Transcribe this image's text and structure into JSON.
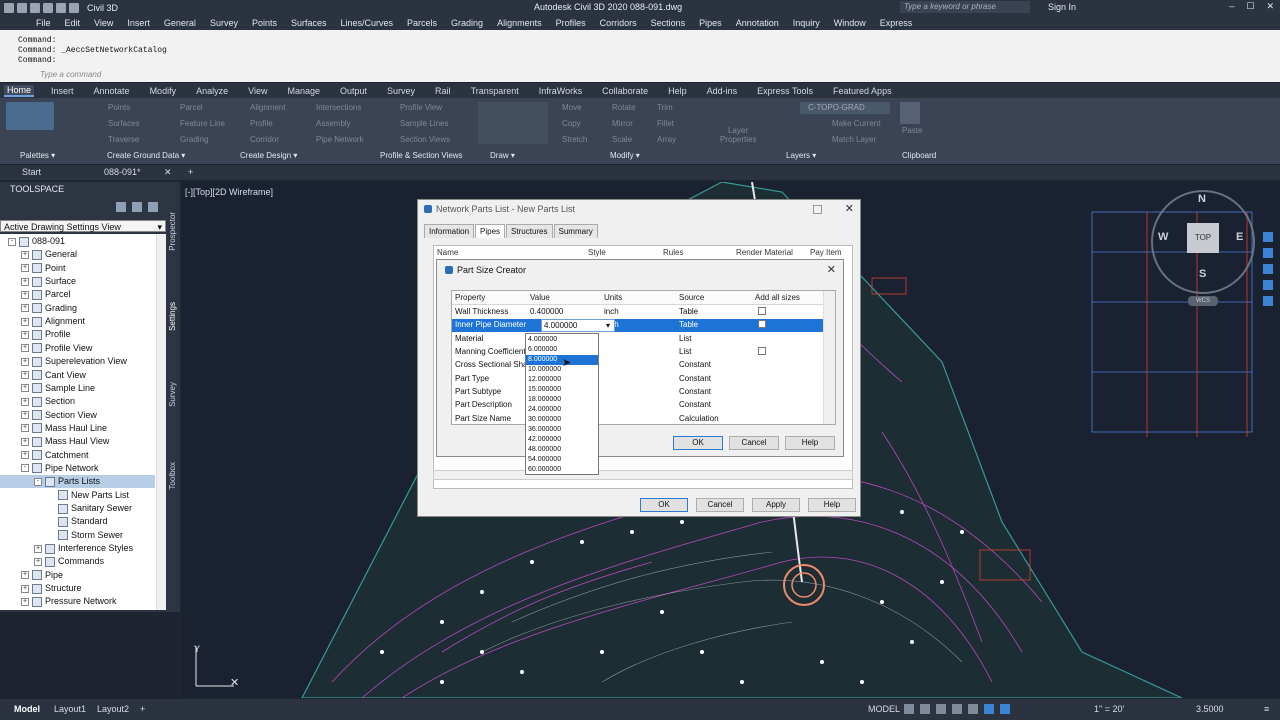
{
  "titlebar": {
    "app_name": "Civil 3D",
    "doc_title": "Autodesk Civil 3D 2020    088-091.dwg",
    "search_placeholder": "Type a keyword or phrase",
    "sign_in": "Sign In"
  },
  "menubar": [
    "File",
    "Edit",
    "View",
    "Insert",
    "General",
    "Survey",
    "Points",
    "Surfaces",
    "Lines/Curves",
    "Parcels",
    "Grading",
    "Alignments",
    "Profiles",
    "Corridors",
    "Sections",
    "Pipes",
    "Annotation",
    "Inquiry",
    "Window",
    "Express"
  ],
  "command": {
    "lines": [
      "Command:",
      "Command: _AeccSetNetworkCatalog",
      "Command:"
    ],
    "input_placeholder": "Type a command"
  },
  "ribbon_tabs": [
    "Home",
    "Insert",
    "Annotate",
    "Modify",
    "Analyze",
    "View",
    "Manage",
    "Output",
    "Survey",
    "Rail",
    "Transparent",
    "InfraWorks",
    "Collaborate",
    "Help",
    "Add-ins",
    "Express Tools",
    "Featured Apps"
  ],
  "ribbon_active": "Home",
  "ribbon_panels": [
    "Palettes ▾",
    "Create Ground Data ▾",
    "Create Design ▾",
    "Profile & Section Views",
    "Draw ▾",
    "Modify ▾",
    "Layers ▾",
    "Clipboard"
  ],
  "ribbon_items": {
    "points": "Points",
    "surfaces": "Surfaces",
    "traverse": "Traverse",
    "parcel": "Parcel",
    "feature_line": "Feature Line",
    "grading": "Grading",
    "alignment": "Alignment",
    "profile": "Profile",
    "corridor": "Corridor",
    "intersections": "Intersections",
    "assembly": "Assembly",
    "pipe_network": "Pipe Network",
    "profile_view": "Profile View",
    "sample_lines": "Sample Lines",
    "section_views": "Section Views",
    "move": "Move",
    "copy": "Copy",
    "stretch": "Stretch",
    "rotate": "Rotate",
    "mirror": "Mirror",
    "scale": "Scale",
    "trim": "Trim",
    "fillet": "Fillet",
    "array": "Array",
    "layer_properties": "Layer Properties",
    "layer_name": "C-TOPO-GRAD",
    "make_current": "Make Current",
    "match_layer": "Match Layer",
    "paste": "Paste"
  },
  "doc_tabs": [
    "Start",
    "088-091*"
  ],
  "toolspace": {
    "title": "TOOLSPACE",
    "view": "Active Drawing Settings View",
    "side_tabs": [
      "Prospector",
      "Settings",
      "Survey",
      "Toolbox"
    ],
    "tree": [
      {
        "label": "088-091",
        "level": 0,
        "exp": "-"
      },
      {
        "label": "General",
        "level": 1,
        "exp": "+"
      },
      {
        "label": "Point",
        "level": 1,
        "exp": "+"
      },
      {
        "label": "Surface",
        "level": 1,
        "exp": "+"
      },
      {
        "label": "Parcel",
        "level": 1,
        "exp": "+"
      },
      {
        "label": "Grading",
        "level": 1,
        "exp": "+"
      },
      {
        "label": "Alignment",
        "level": 1,
        "exp": "+"
      },
      {
        "label": "Profile",
        "level": 1,
        "exp": "+"
      },
      {
        "label": "Profile View",
        "level": 1,
        "exp": "+"
      },
      {
        "label": "Superelevation View",
        "level": 1,
        "exp": "+"
      },
      {
        "label": "Cant View",
        "level": 1,
        "exp": "+"
      },
      {
        "label": "Sample Line",
        "level": 1,
        "exp": "+"
      },
      {
        "label": "Section",
        "level": 1,
        "exp": "+"
      },
      {
        "label": "Section View",
        "level": 1,
        "exp": "+"
      },
      {
        "label": "Mass Haul Line",
        "level": 1,
        "exp": "+"
      },
      {
        "label": "Mass Haul View",
        "level": 1,
        "exp": "+"
      },
      {
        "label": "Catchment",
        "level": 1,
        "exp": "+"
      },
      {
        "label": "Pipe Network",
        "level": 1,
        "exp": "-"
      },
      {
        "label": "Parts Lists",
        "level": 2,
        "exp": "-",
        "selected": true
      },
      {
        "label": "New Parts List",
        "level": 3,
        "exp": ""
      },
      {
        "label": "Sanitary Sewer",
        "level": 3,
        "exp": ""
      },
      {
        "label": "Standard",
        "level": 3,
        "exp": ""
      },
      {
        "label": "Storm Sewer",
        "level": 3,
        "exp": ""
      },
      {
        "label": "Interference Styles",
        "level": 2,
        "exp": "+"
      },
      {
        "label": "Commands",
        "level": 2,
        "exp": "+"
      },
      {
        "label": "Pipe",
        "level": 1,
        "exp": "+"
      },
      {
        "label": "Structure",
        "level": 1,
        "exp": "+"
      },
      {
        "label": "Pressure Network",
        "level": 1,
        "exp": "+"
      }
    ]
  },
  "viewport": {
    "label": "[-][Top][2D Wireframe]",
    "compass": {
      "n": "N",
      "s": "S",
      "e": "E",
      "w": "W",
      "top": "TOP",
      "wcs": "WCS"
    }
  },
  "dialog_parts_list": {
    "title": "Network Parts List - New Parts List",
    "tabs": [
      "Information",
      "Pipes",
      "Structures",
      "Summary"
    ],
    "active_tab": "Pipes",
    "columns": [
      "Name",
      "Style",
      "Rules",
      "Render Material",
      "Pay Item"
    ],
    "buttons": {
      "ok": "OK",
      "cancel": "Cancel",
      "apply": "Apply",
      "help": "Help"
    }
  },
  "dialog_part_size": {
    "title": "Part Size Creator",
    "columns": [
      "Property",
      "Value",
      "Units",
      "Source",
      "Add all sizes"
    ],
    "rows": [
      {
        "property": "Wall Thickness",
        "value": "0.400000",
        "units": "inch",
        "source": "Table",
        "check": true
      },
      {
        "property": "Inner Pipe Diameter",
        "value": "4.000000",
        "units": "inch",
        "source": "Table",
        "check": true,
        "selected": true
      },
      {
        "property": "Material",
        "value": "",
        "units": "",
        "source": "List",
        "check": false
      },
      {
        "property": "Manning Coefficient",
        "value": "",
        "units": "",
        "source": "List",
        "check": true
      },
      {
        "property": "Cross Sectional Shape",
        "value": "",
        "units": "",
        "source": "Constant",
        "check": false
      },
      {
        "property": "Part Type",
        "value": "",
        "units": "",
        "source": "Constant",
        "check": false
      },
      {
        "property": "Part Subtype",
        "value": "",
        "units": "",
        "source": "Constant",
        "check": false
      },
      {
        "property": "Part Description",
        "value": "",
        "units": "",
        "source": "Constant",
        "check": false
      },
      {
        "property": "Part Size Name",
        "value": "",
        "units": "",
        "source": "Calculation",
        "check": false
      }
    ],
    "dropdown": [
      "4.000000",
      "6.000000",
      "8.000000",
      "10.000000",
      "12.000000",
      "15.000000",
      "18.000000",
      "24.000000",
      "30.000000",
      "36.000000",
      "42.000000",
      "48.000000",
      "54.000000",
      "60.000000"
    ],
    "dropdown_hover": 2,
    "buttons": {
      "ok": "OK",
      "cancel": "Cancel",
      "help": "Help"
    }
  },
  "statusbar": {
    "tabs": [
      "Model",
      "Layout1",
      "Layout2"
    ],
    "model_label": "MODEL",
    "scale": "1\" = 20'",
    "zoom": "3.5000"
  },
  "colors": {
    "accent": "#1e74d6",
    "canvas": "#1a2130",
    "chrome": "#2b3340"
  }
}
